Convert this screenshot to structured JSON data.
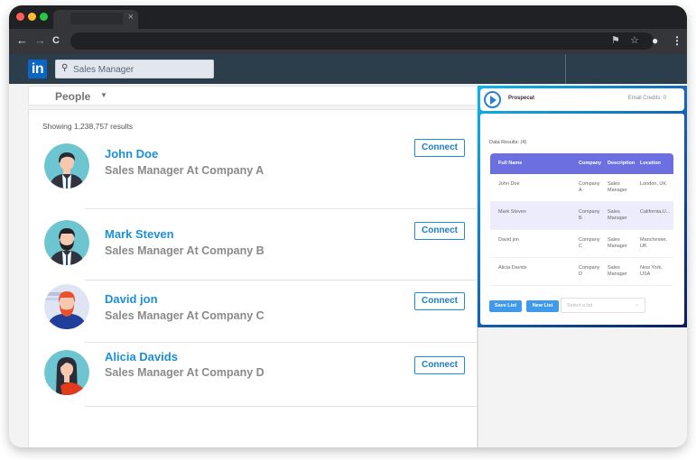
{
  "browser": {
    "tab_close": "×",
    "nav": {
      "back": "←",
      "forward": "→",
      "reload": "C"
    },
    "toolbar_icons": {
      "translate": "⚑",
      "bookmark": "☆",
      "profile": "●",
      "menu": "⋮"
    },
    "traffic_colors": {
      "close": "#ff5f57",
      "minimize": "#febc2e",
      "zoom": "#28c840"
    }
  },
  "linkedin": {
    "logo": "in",
    "search": {
      "icon": "⚲",
      "value": "Sales Manager"
    },
    "filter": {
      "label": "People",
      "caret": "▼"
    },
    "results_count": "Showing 1,238,757 results",
    "connect_label": "Connect",
    "people": [
      {
        "name": "John Doe",
        "title": "Sales Manager At Company A"
      },
      {
        "name": "Mark Steven",
        "title": "Sales Manager At Company B"
      },
      {
        "name": "David jon",
        "title": "Sales Manager At Company C"
      },
      {
        "name": "Alicia Davids",
        "title": "Sales Manager At Company D"
      }
    ]
  },
  "extension": {
    "brand": "Prospecat",
    "credits": "Email Credits: 0",
    "results_label": "Data Results: (4)",
    "columns": [
      "Full Name",
      "Company",
      "Description",
      "Location"
    ],
    "rows": [
      {
        "name": "John Doe",
        "company": "Company A",
        "description": "Sales Manager",
        "location": "London, UK"
      },
      {
        "name": "Mark Steven",
        "company": "Company B",
        "description": "Sales Manager",
        "location": "California,U..."
      },
      {
        "name": "David jon",
        "company": "Company C",
        "description": "Sales Manager",
        "location": "Manchester, UK"
      },
      {
        "name": "Alicia Davids",
        "company": "Company D",
        "description": "Sales Manager",
        "location": "New York, USA"
      }
    ],
    "save_list": "Save List",
    "new_list": "New List",
    "select_placeholder": "Select a list",
    "select_caret": "⌄"
  },
  "colors": {
    "linkedin_blue": "#0a66c2",
    "link_blue": "#1b8fd9",
    "header_bg": "#2c3e4c",
    "table_header": "#6b6fe0",
    "ext_button": "#3f9aeb"
  }
}
